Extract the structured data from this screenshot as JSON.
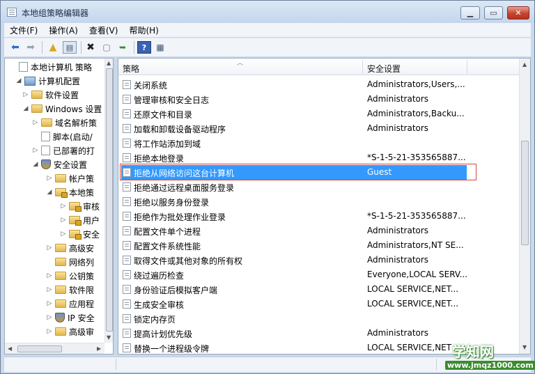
{
  "window": {
    "title": "本地组策略编辑器"
  },
  "menu": [
    "文件(F)",
    "操作(A)",
    "查看(V)",
    "帮助(H)"
  ],
  "toolbar": [
    "back-arrow-icon",
    "forward-arrow-icon",
    "up-folder-icon",
    "show-hide-tree-icon",
    "delete-icon",
    "properties-icon",
    "export-icon",
    "help-icon",
    "view-icon"
  ],
  "tree": [
    {
      "label": "本地计算机 策略",
      "twisty": "",
      "icon": "doc",
      "indent": 0
    },
    {
      "label": "计算机配置",
      "twisty": "◢",
      "icon": "pc",
      "indent": 1
    },
    {
      "label": "软件设置",
      "twisty": "▷",
      "icon": "folder",
      "indent": 2
    },
    {
      "label": "Windows 设置",
      "twisty": "◢",
      "icon": "folder",
      "indent": 2
    },
    {
      "label": "域名解析策",
      "twisty": "▷",
      "icon": "folder",
      "indent": 3
    },
    {
      "label": "脚本(启动/",
      "twisty": "",
      "icon": "doc",
      "indent": 3
    },
    {
      "label": "已部署的打",
      "twisty": "▷",
      "icon": "doc",
      "indent": 3
    },
    {
      "label": "安全设置",
      "twisty": "◢",
      "icon": "shield",
      "indent": 3
    },
    {
      "label": "帐户策",
      "twisty": "▷",
      "icon": "folder",
      "indent": 4
    },
    {
      "label": "本地策",
      "twisty": "◢",
      "icon": "folderlock",
      "indent": 4
    },
    {
      "label": "审核",
      "twisty": "▷",
      "icon": "folderlock",
      "indent": 5
    },
    {
      "label": "用户",
      "twisty": "▷",
      "icon": "folderlock",
      "indent": 5
    },
    {
      "label": "安全",
      "twisty": "▷",
      "icon": "folderlock",
      "indent": 5
    },
    {
      "label": "高级安",
      "twisty": "▷",
      "icon": "folder",
      "indent": 4
    },
    {
      "label": "网络列",
      "twisty": "",
      "icon": "folder",
      "indent": 4
    },
    {
      "label": "公钥策",
      "twisty": "▷",
      "icon": "folder",
      "indent": 4
    },
    {
      "label": "软件限",
      "twisty": "▷",
      "icon": "folder",
      "indent": 4
    },
    {
      "label": "应用程",
      "twisty": "▷",
      "icon": "folder",
      "indent": 4
    },
    {
      "label": "IP 安全",
      "twisty": "▷",
      "icon": "shield",
      "indent": 4
    },
    {
      "label": "高级审",
      "twisty": "▷",
      "icon": "folder",
      "indent": 4
    }
  ],
  "list": {
    "col_policy": "策略",
    "col_setting": "安全设置",
    "rows": [
      {
        "policy": "关闭系统",
        "setting": "Administrators,Users,..."
      },
      {
        "policy": "管理审核和安全日志",
        "setting": "Administrators"
      },
      {
        "policy": "还原文件和目录",
        "setting": "Administrators,Backu..."
      },
      {
        "policy": "加载和卸载设备驱动程序",
        "setting": "Administrators"
      },
      {
        "policy": "将工作站添加到域",
        "setting": ""
      },
      {
        "policy": "拒绝本地登录",
        "setting": "*S-1-5-21-353565887..."
      },
      {
        "policy": "拒绝从网络访问这台计算机",
        "setting": "Guest",
        "selected": true
      },
      {
        "policy": "拒绝通过远程桌面服务登录",
        "setting": ""
      },
      {
        "policy": "拒绝以服务身份登录",
        "setting": ""
      },
      {
        "policy": "拒绝作为批处理作业登录",
        "setting": "*S-1-5-21-353565887..."
      },
      {
        "policy": "配置文件单个进程",
        "setting": "Administrators"
      },
      {
        "policy": "配置文件系统性能",
        "setting": "Administrators,NT SE..."
      },
      {
        "policy": "取得文件或其他对象的所有权",
        "setting": "Administrators"
      },
      {
        "policy": "绕过遍历检查",
        "setting": "Everyone,LOCAL SERV..."
      },
      {
        "policy": "身份验证后模拟客户端",
        "setting": "LOCAL SERVICE,NET..."
      },
      {
        "policy": "生成安全审核",
        "setting": "LOCAL SERVICE,NET..."
      },
      {
        "policy": "锁定内存页",
        "setting": ""
      },
      {
        "policy": "提高计划优先级",
        "setting": "Administrators"
      },
      {
        "policy": "替换一个进程级令牌",
        "setting": "LOCAL SERVICE,NET"
      }
    ]
  },
  "watermark": {
    "title": "学知网",
    "url": "www.jmqz1000.com"
  }
}
